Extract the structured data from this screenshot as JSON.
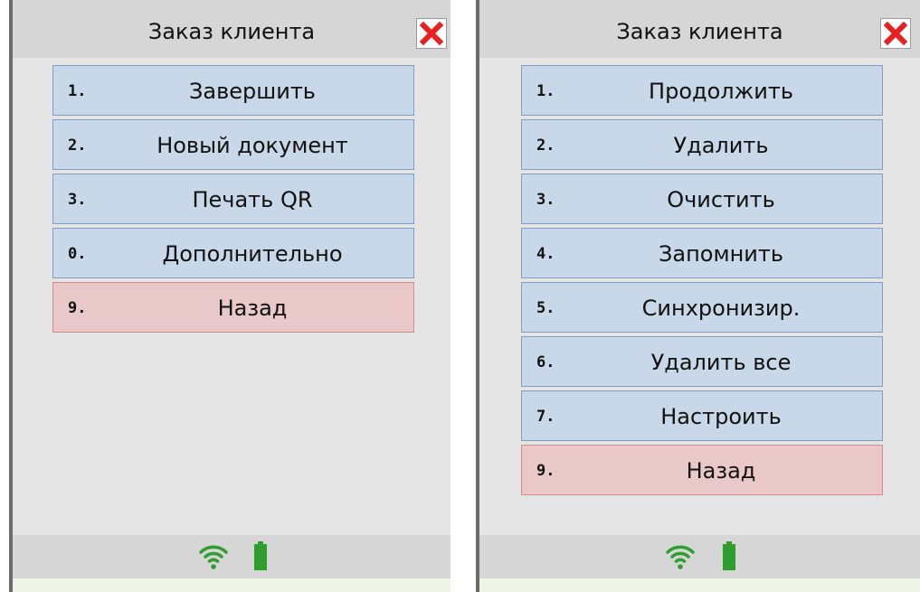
{
  "left": {
    "title": "Заказ клиента",
    "items": [
      {
        "num": "1.",
        "label": "Завершить"
      },
      {
        "num": "2.",
        "label": "Новый документ"
      },
      {
        "num": "3.",
        "label": "Печать QR"
      },
      {
        "num": "0.",
        "label": "Дополнительно"
      },
      {
        "num": "9.",
        "label": "Назад"
      }
    ]
  },
  "right": {
    "title": "Заказ клиента",
    "items": [
      {
        "num": "1.",
        "label": "Продолжить"
      },
      {
        "num": "2.",
        "label": "Удалить"
      },
      {
        "num": "3.",
        "label": "Очистить"
      },
      {
        "num": "4.",
        "label": "Запомнить"
      },
      {
        "num": "5.",
        "label": "Синхронизир."
      },
      {
        "num": "6.",
        "label": "Удалить все"
      },
      {
        "num": "7.",
        "label": "Настроить"
      },
      {
        "num": "9.",
        "label": "Назад"
      }
    ]
  },
  "icons": {
    "close": "close-icon",
    "wifi": "wifi-icon",
    "battery": "battery-icon"
  },
  "colors": {
    "menu_item_bg": "#c8d8e8",
    "back_item_bg": "#e8c8c8",
    "close_red": "#e8201f",
    "status_green": "#2f9e2f"
  }
}
